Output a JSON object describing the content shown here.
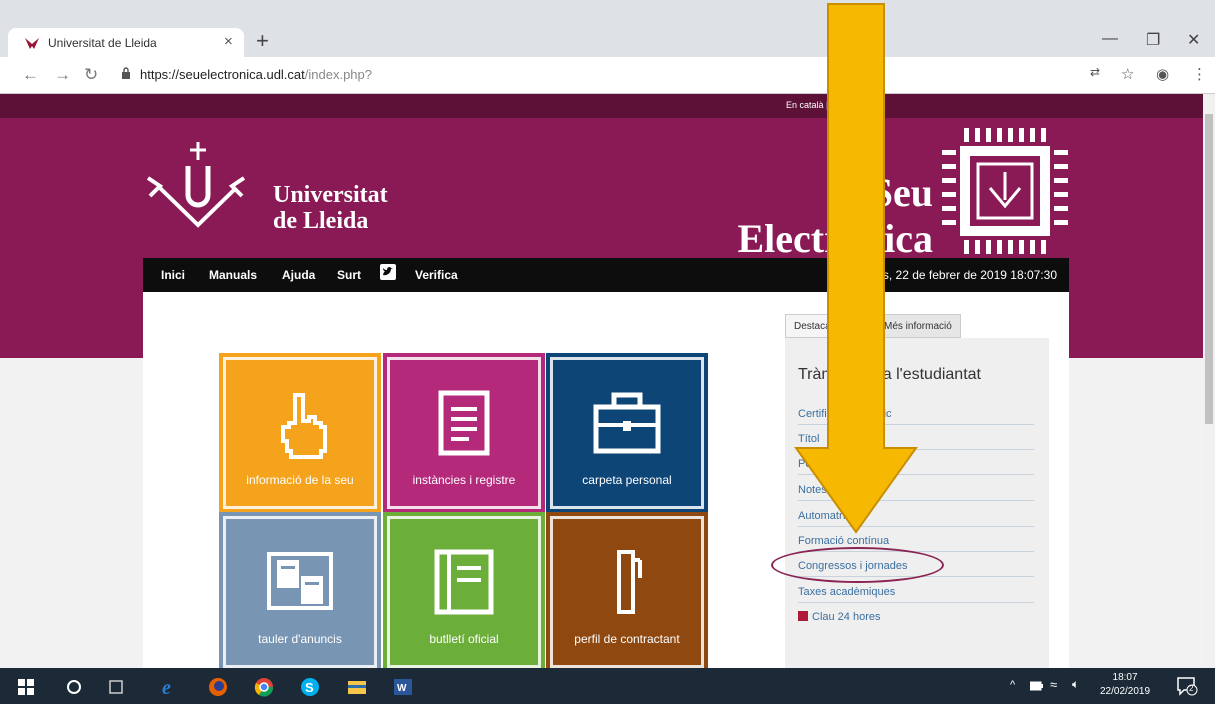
{
  "browser": {
    "tab_title": "Universitat de Lleida",
    "tab_close": "×",
    "new_tab": "+",
    "url_host": "https://seuelectronica.udl.cat",
    "url_path": "/index.php?"
  },
  "page": {
    "language_links": "En català | Castellano",
    "logo_line1": "Universitat",
    "logo_line2": "de Lleida",
    "seu_line1": "Seu",
    "seu_line2": "Electrònica",
    "menu": [
      "Inici",
      "Manuals",
      "Ajuda",
      "Surt",
      "Verifica"
    ],
    "datetime": "Divendres, 22 de febrer de 2019 18:07:30",
    "tiles": [
      {
        "label": "informació de la seu",
        "color": "#f5a31c"
      },
      {
        "label": "instàncies i registre",
        "color": "#b5297b"
      },
      {
        "label": "carpeta personal",
        "color": "#0e4577"
      },
      {
        "label": "tauler d'anuncis",
        "color": "#7896b4"
      },
      {
        "label": "butlletí oficial",
        "color": "#6cae3a"
      },
      {
        "label": "perfil de contractant",
        "color": "#8e4810"
      }
    ],
    "panel_tabs": [
      "Destacats",
      "Més informació"
    ],
    "panel_title": "Tràmits per a l'estudiantat",
    "panel_links": [
      "Certificat acadèmic",
      "Títol",
      "Permisos",
      "Notes",
      "Automatrícula",
      "Formació contínua",
      "Congressos i jornades",
      "Taxes acadèmiques",
      "Clau 24 hores"
    ]
  },
  "annotation": {
    "arrow_color": "#f6b800",
    "highlight_color": "#8a2454"
  },
  "taskbar": {
    "time": "18:07",
    "date": "22/02/2019",
    "notification_count": "2"
  },
  "colors": {
    "brand": "#8a1a55",
    "brand_dark": "#5e1136"
  }
}
